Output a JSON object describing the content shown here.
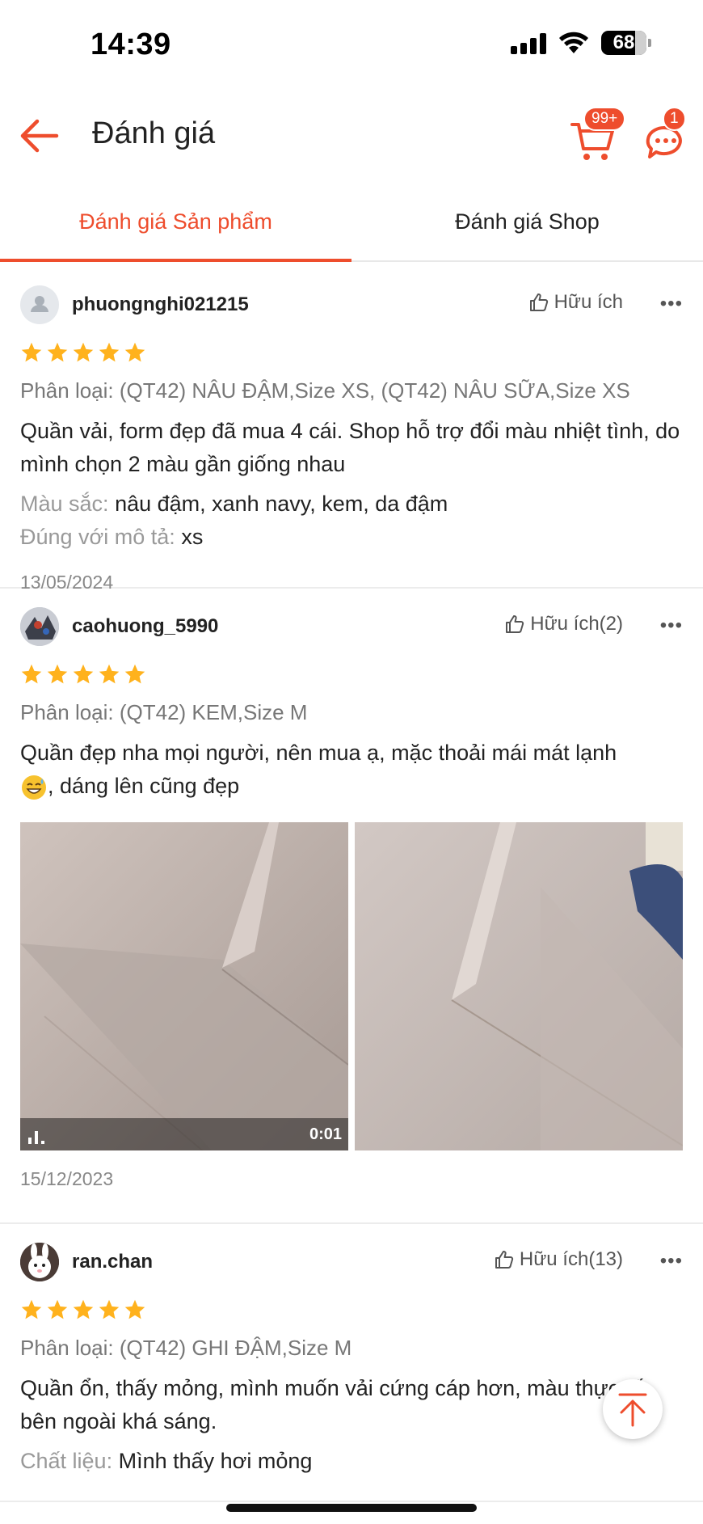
{
  "status_bar": {
    "time": "14:39",
    "battery": "68"
  },
  "header": {
    "title": "Đánh giá",
    "cart_badge": "99+",
    "chat_badge": "1"
  },
  "tabs": [
    {
      "label": "Đánh giá Sản phẩm",
      "active": true
    },
    {
      "label": "Đánh giá Shop",
      "active": false
    }
  ],
  "reviews": [
    {
      "username": "phuongnghi021215",
      "helpful": "Hữu ích",
      "more": "•••",
      "rating": 5,
      "variation": "Phân loại: (QT42) NÂU ĐẬM,Size XS, (QT42) NÂU SỮA,Size XS",
      "comment": "Quần vải, form đẹp đã mua 4 cái. Shop hỗ trợ đổi màu nhiệt tình, do mình chọn 2 màu gần giống nhau",
      "attributes": [
        {
          "key": "Màu sắc:",
          "value": "nâu đậm, xanh navy, kem, da đậm"
        },
        {
          "key": "Đúng với mô tả:",
          "value": "xs"
        }
      ],
      "date": "13/05/2024"
    },
    {
      "username": "caohuong_5990",
      "helpful": "Hữu ích(2)",
      "more": "•••",
      "rating": 5,
      "variation": "Phân loại: (QT42) KEM,Size M",
      "comment_before_emoji": "Quần đẹp nha mọi người, nên mua ạ, mặc thoải mái mát lạnh",
      "comment_after_emoji": ", dáng lên cũng đẹp",
      "video_duration": "0:01",
      "date": "15/12/2023"
    },
    {
      "username": "ran.chan",
      "helpful": "Hữu ích(13)",
      "more": "•••",
      "rating": 5,
      "variation": "Phân loại: (QT42) GHI ĐẬM,Size M",
      "comment": "Quần ổn, thấy mỏng, mình muốn vải cứng cáp hơn, màu thực tế bên ngoài khá sáng.",
      "attributes": [
        {
          "key": "Chất liệu:",
          "value": "Mình thấy hơi mỏng"
        }
      ]
    }
  ],
  "colors": {
    "accent": "#ee4d2d",
    "star": "#ffb21d"
  }
}
